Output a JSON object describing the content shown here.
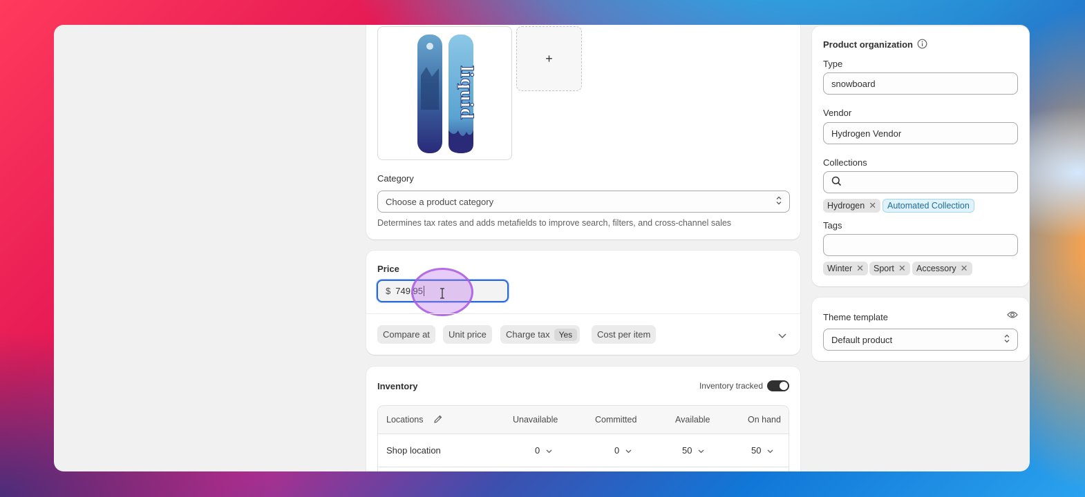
{
  "category": {
    "label": "Category",
    "placeholder": "Choose a product category",
    "helper": "Determines tax rates and adds metafields to improve search, filters, and cross-channel sales"
  },
  "media": {
    "add_label": "+"
  },
  "price": {
    "label": "Price",
    "currency": "$",
    "value": "749.95",
    "chips": {
      "compare_at": "Compare at",
      "unit_price": "Unit price",
      "charge_tax": "Charge tax",
      "charge_tax_value": "Yes",
      "cost_per_item": "Cost per item"
    }
  },
  "inventory": {
    "title": "Inventory",
    "tracked_label": "Inventory tracked",
    "tracked": true,
    "columns": {
      "locations": "Locations",
      "unavailable": "Unavailable",
      "committed": "Committed",
      "available": "Available",
      "on_hand": "On hand"
    },
    "rows": [
      {
        "location": "Shop location",
        "unavailable": "0",
        "committed": "0",
        "available": "50",
        "on_hand": "50"
      }
    ]
  },
  "organization": {
    "title": "Product organization",
    "type_label": "Type",
    "type_value": "snowboard",
    "vendor_label": "Vendor",
    "vendor_value": "Hydrogen Vendor",
    "collections_label": "Collections",
    "collections": [
      "Hydrogen",
      "Automated Collection"
    ],
    "tags_label": "Tags",
    "tags": [
      "Winter",
      "Sport",
      "Accessory"
    ]
  },
  "theme": {
    "title": "Theme template",
    "value": "Default product"
  },
  "colors": {
    "focus_ring": "#2b6bd6",
    "collection_chip_bg": "#e0f2fb",
    "toggle_on": "#303030"
  },
  "icons": [
    "plus-icon",
    "chevron-updown-icon",
    "chevron-down-icon",
    "text-cursor-icon",
    "pencil-icon",
    "info-icon",
    "search-icon",
    "close-icon",
    "eye-icon"
  ]
}
